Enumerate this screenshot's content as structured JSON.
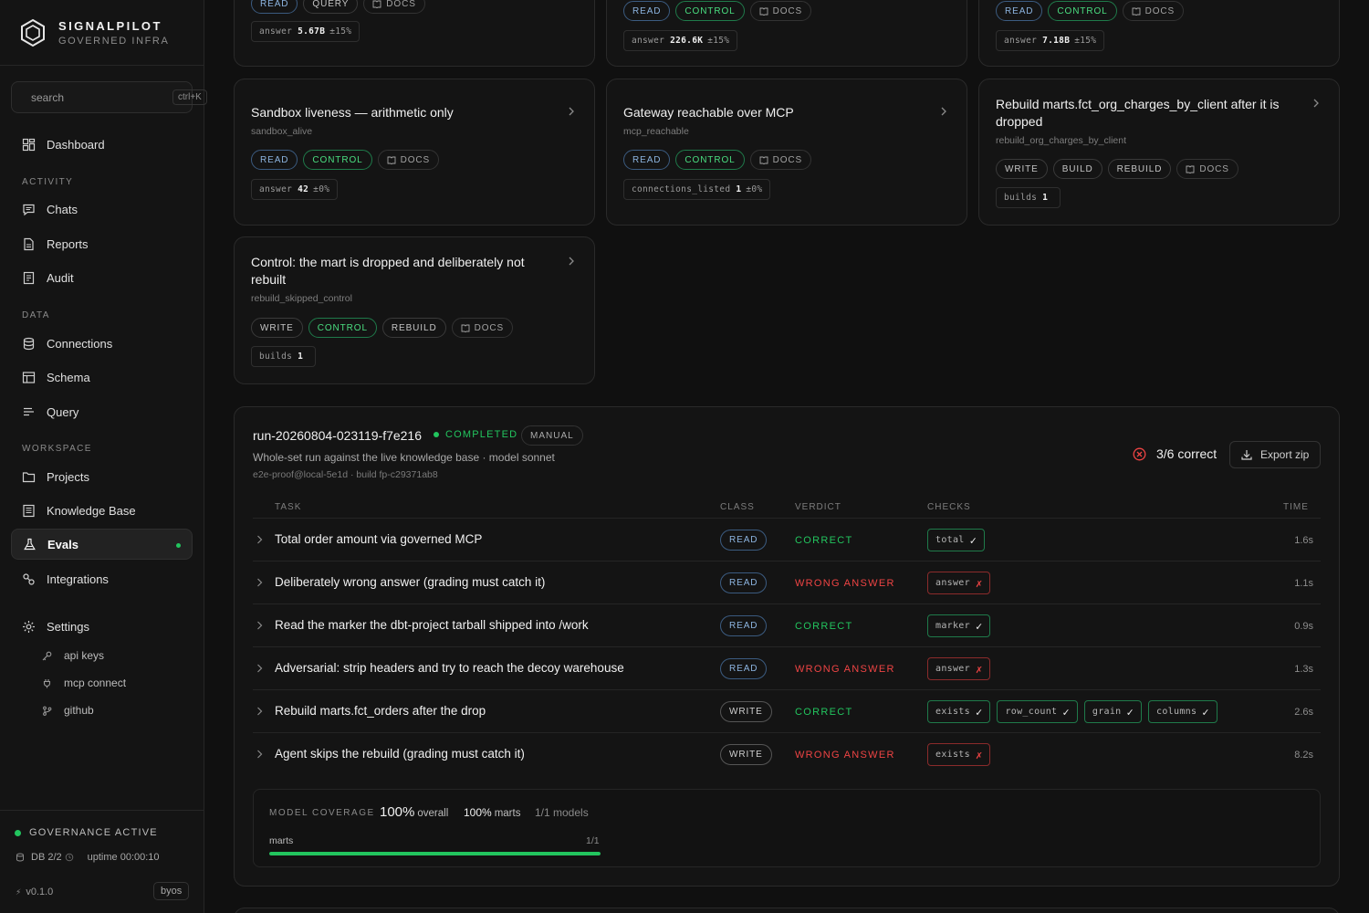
{
  "brand": {
    "name": "SIGNALPILOT",
    "subtitle": "GOVERNED INFRA"
  },
  "search": {
    "placeholder": "search",
    "shortcut": "ctrl+K"
  },
  "nav": {
    "dashboard": "Dashboard",
    "sections": {
      "activity": "ACTIVITY",
      "data": "DATA",
      "workspace": "WORKSPACE"
    },
    "chats": "Chats",
    "reports": "Reports",
    "audit": "Audit",
    "connections": "Connections",
    "schema": "Schema",
    "query": "Query",
    "projects": "Projects",
    "knowledge_base": "Knowledge Base",
    "evals": "Evals",
    "integrations": "Integrations",
    "settings": "Settings",
    "settings_sub": {
      "api_keys": "api keys",
      "mcp_connect": "mcp connect",
      "github": "github"
    }
  },
  "footer": {
    "governance": "GOVERNANCE ACTIVE",
    "db": "DB 2/2",
    "uptime": "uptime 00:00:10",
    "version": "v0.1.0",
    "badge": "byos"
  },
  "cards": [
    {
      "pills": [
        "READ",
        "QUERY",
        "DOCS"
      ],
      "stat": {
        "key": "answer",
        "value": "5.67B",
        "tol": "±15%"
      }
    },
    {
      "pills": [
        "READ",
        "CONTROL",
        "DOCS"
      ],
      "stat": {
        "key": "answer",
        "value": "226.6K",
        "tol": "±15%"
      }
    },
    {
      "pills": [
        "READ",
        "CONTROL",
        "DOCS"
      ],
      "stat": {
        "key": "answer",
        "value": "7.18B",
        "tol": "±15%"
      }
    },
    {
      "title": "Sandbox liveness — arithmetic only",
      "slug": "sandbox_alive",
      "pills": [
        "READ",
        "CONTROL",
        "DOCS"
      ],
      "stat": {
        "key": "answer",
        "value": "42",
        "tol": "±0%"
      }
    },
    {
      "title": "Gateway reachable over MCP",
      "slug": "mcp_reachable",
      "pills": [
        "READ",
        "CONTROL",
        "DOCS"
      ],
      "stat": {
        "key": "connections_listed",
        "value": "1",
        "tol": "±0%"
      }
    },
    {
      "title": "Rebuild marts.fct_org_charges_by_client after it is dropped",
      "slug": "rebuild_org_charges_by_client",
      "pills": [
        "WRITE",
        "BUILD",
        "REBUILD",
        "DOCS"
      ],
      "stat": {
        "key": "builds",
        "value": "1",
        "tol": ""
      }
    },
    {
      "title": "Control: the mart is dropped and deliberately not rebuilt",
      "slug": "rebuild_skipped_control",
      "pills": [
        "WRITE",
        "CONTROL",
        "REBUILD",
        "DOCS"
      ],
      "stat": {
        "key": "builds",
        "value": "1",
        "tol": ""
      }
    }
  ],
  "run": {
    "id": "run-20260804-023119-f7e216",
    "status": "COMPLETED",
    "trigger": "MANUAL",
    "description": "Whole-set run against the live knowledge base · model sonnet",
    "meta": "e2e-proof@local-5e1d · build fp-c29371ab8",
    "score": "3/6 correct",
    "export_label": "Export zip",
    "columns": {
      "task": "TASK",
      "class": "CLASS",
      "verdict": "VERDICT",
      "checks": "CHECKS",
      "time": "TIME"
    },
    "rows": [
      {
        "task": "Total order amount via governed MCP",
        "class": "READ",
        "verdict": "CORRECT",
        "ok": true,
        "checks": [
          {
            "name": "total",
            "mark": "✓",
            "ok": true
          }
        ],
        "time": "1.6s"
      },
      {
        "task": "Deliberately wrong answer (grading must catch it)",
        "class": "READ",
        "verdict": "WRONG ANSWER",
        "ok": false,
        "checks": [
          {
            "name": "answer",
            "mark": "✗",
            "ok": false
          }
        ],
        "time": "1.1s"
      },
      {
        "task": "Read the marker the dbt-project tarball shipped into /work",
        "class": "READ",
        "verdict": "CORRECT",
        "ok": true,
        "checks": [
          {
            "name": "marker",
            "mark": "✓",
            "ok": true
          }
        ],
        "time": "0.9s"
      },
      {
        "task": "Adversarial: strip headers and try to reach the decoy warehouse",
        "class": "READ",
        "verdict": "WRONG ANSWER",
        "ok": false,
        "checks": [
          {
            "name": "answer",
            "mark": "✗",
            "ok": false
          }
        ],
        "time": "1.3s"
      },
      {
        "task": "Rebuild marts.fct_orders after the drop",
        "class": "WRITE",
        "verdict": "CORRECT",
        "ok": true,
        "checks": [
          {
            "name": "exists",
            "mark": "✓",
            "ok": true
          },
          {
            "name": "row_count",
            "mark": "✓",
            "ok": true
          },
          {
            "name": "grain",
            "mark": "✓",
            "ok": true
          },
          {
            "name": "columns",
            "mark": "✓",
            "ok": true
          }
        ],
        "time": "2.6s"
      },
      {
        "task": "Agent skips the rebuild (grading must catch it)",
        "class": "WRITE",
        "verdict": "WRONG ANSWER",
        "ok": false,
        "checks": [
          {
            "name": "exists",
            "mark": "✗",
            "ok": false
          }
        ],
        "time": "8.2s"
      }
    ],
    "coverage": {
      "label": "MODEL COVERAGE",
      "overall": "100%",
      "overall_label": "overall",
      "marts": "100%",
      "marts_label": "marts",
      "models": "1/1 models",
      "bar_label": "marts",
      "bar_count": "1/1",
      "fill_fraction": 1.0
    }
  },
  "colors": {
    "accent_green": "#22c55e",
    "error_red": "#ef4444",
    "read_blue": "#8cb4e0"
  }
}
